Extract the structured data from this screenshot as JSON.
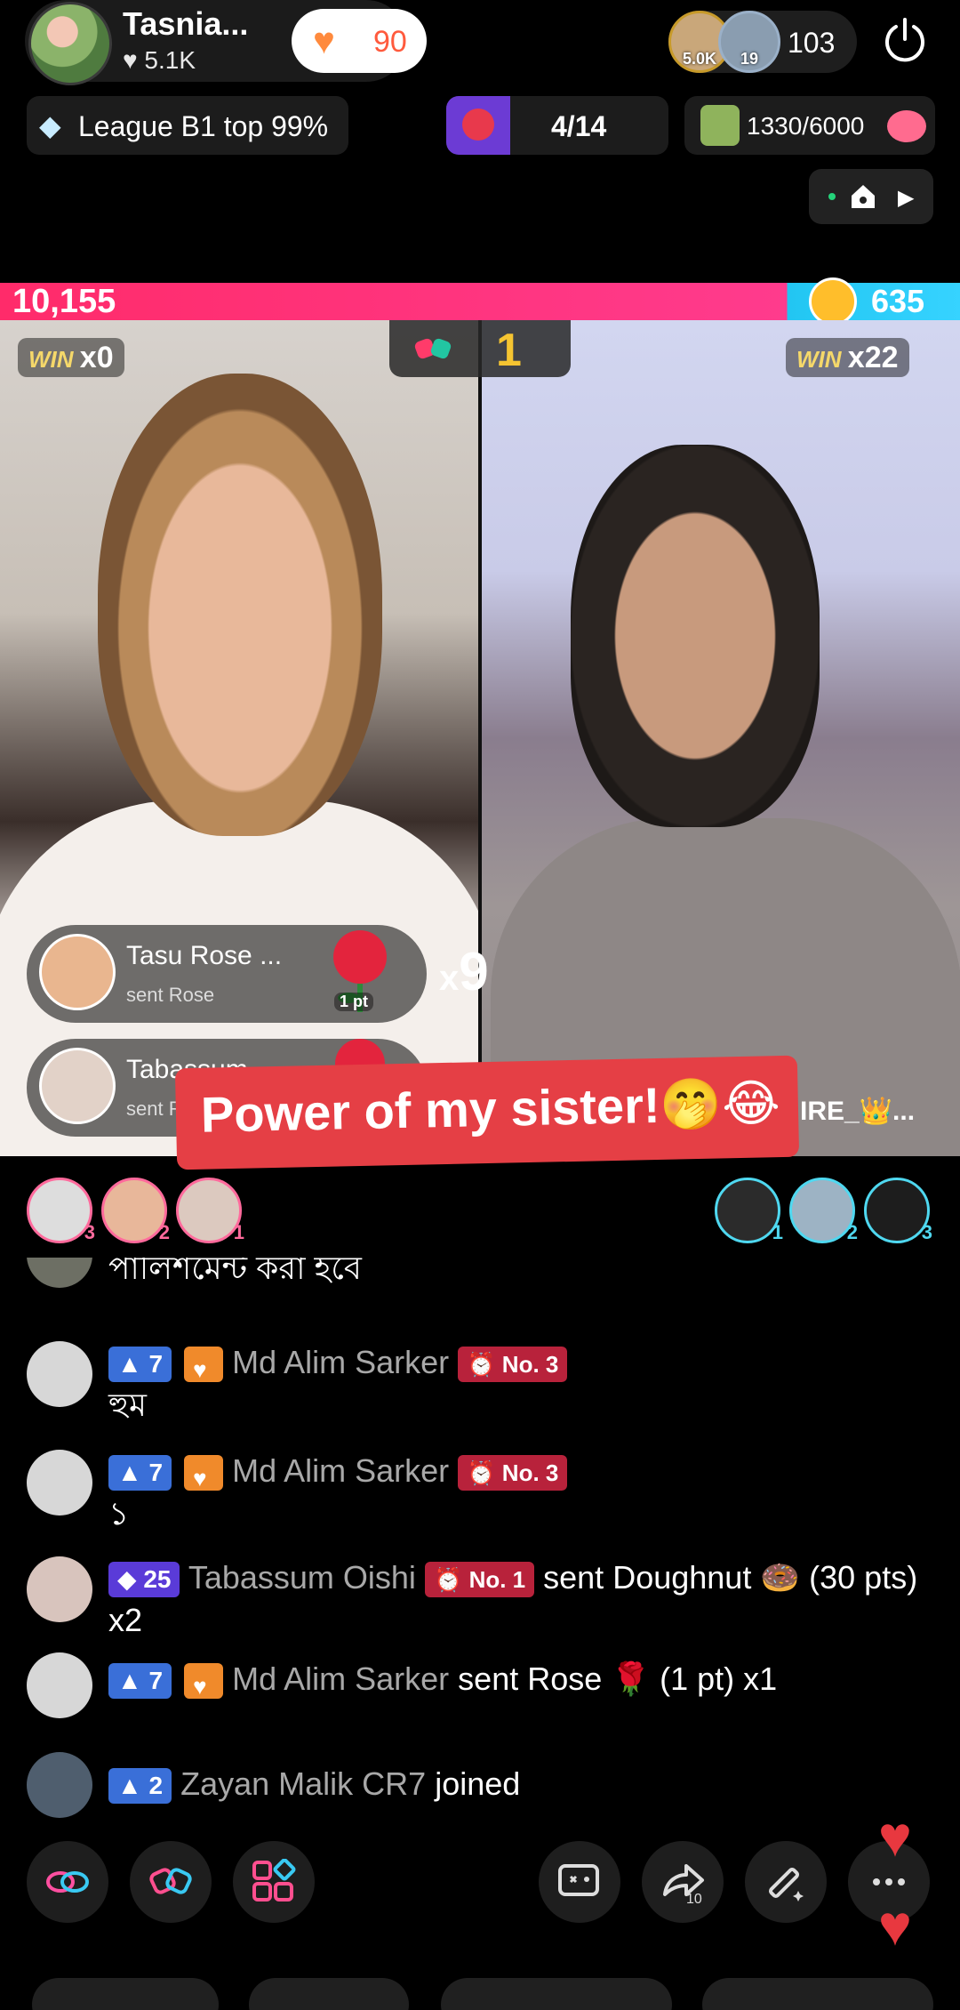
{
  "host": {
    "name": "Tasnia...",
    "likes": "♥ 5.1K",
    "follow_count": "90"
  },
  "viewers": {
    "badges": [
      "5.0K",
      "19"
    ],
    "count": "103"
  },
  "league": {
    "text": "League B1 top 99%"
  },
  "rank": {
    "text": "4/14"
  },
  "goal": {
    "text": "1330/6000"
  },
  "battle": {
    "left_score": "10,155",
    "right_score": "635",
    "left_win_label": "WIN",
    "left_win": "x0",
    "right_win_label": "WIN",
    "right_win": "x22",
    "round": "1"
  },
  "gifts": [
    {
      "name": "Tasu Rose ...",
      "sub": "sent Rose",
      "pt": "1 pt"
    },
    {
      "name": "Tabassum",
      "sub": "sent R",
      "pt": ""
    }
  ],
  "gift_multiplier": "x",
  "gift_multiplier_n": "9",
  "caption": "Power of my sister!🤭😂",
  "right_tag": "IRE_👑...",
  "supporters_left": [
    "3",
    "2",
    "1"
  ],
  "supporters_right": [
    "1",
    "2",
    "3"
  ],
  "chat": {
    "m0_text": "পালিশমেন্ট করা হবে",
    "m1": {
      "level": "7",
      "user": "Md Alim Sarker",
      "rank": "No. 3",
      "text": "হুম"
    },
    "m2": {
      "level": "7",
      "user": "Md Alim Sarker",
      "rank": "No. 3",
      "text": "১"
    },
    "m3": {
      "level": "25",
      "user": "Tabassum Oishi",
      "rank": "No. 1",
      "text": " sent Doughnut 🍩 (30 pts) x2"
    },
    "m4": {
      "level": "7",
      "user": "Md Alim Sarker",
      "text": " sent Rose 🌹 (1 pt) x1"
    },
    "m5": {
      "level": "2",
      "user": "Zayan Malik CR7",
      "text": " joined"
    }
  },
  "toolbar": {
    "share_badge": "10"
  },
  "colors": {
    "accent_pink": "#ff3b8d",
    "accent_blue": "#22c6f2",
    "caption_red": "#e53f45"
  }
}
